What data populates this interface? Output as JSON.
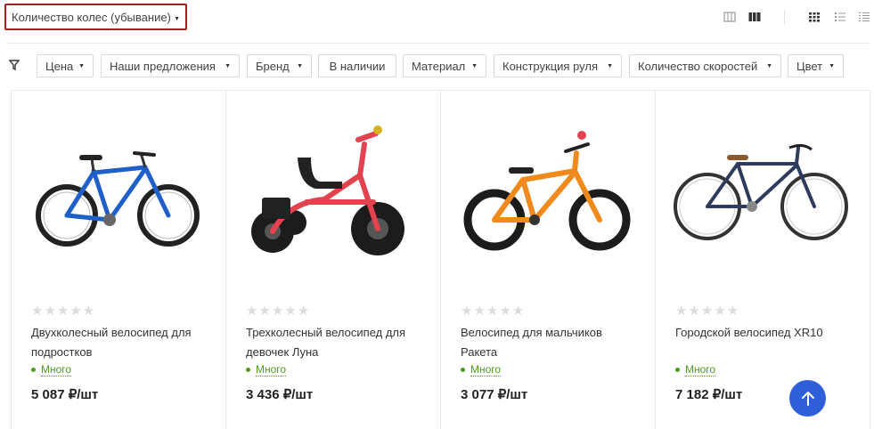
{
  "sort": {
    "label": "Количество колес (убывание)"
  },
  "view": {
    "icons": [
      "grid-small-icon",
      "grid-large-icon",
      "tile-view-icon",
      "list-view-icon",
      "compact-list-icon"
    ]
  },
  "filters": [
    {
      "label": "Цена"
    },
    {
      "label": "Наши предложения"
    },
    {
      "label": "Бренд"
    },
    {
      "label": "В наличии"
    },
    {
      "label": "Материал"
    },
    {
      "label": "Конструкция руля"
    },
    {
      "label": "Количество скоростей"
    },
    {
      "label": "Цвет"
    }
  ],
  "products": [
    {
      "name": "Двухколесный велосипед для подростков",
      "stock": "Много",
      "price": "5 087 ₽/шт",
      "rating": 0,
      "color": "#1f5fc9"
    },
    {
      "name": "Трехколесный велосипед для девочек Луна",
      "stock": "Много",
      "price": "3 436 ₽/шт",
      "rating": 0,
      "color": "#e2434f"
    },
    {
      "name": "Велосипед для мальчиков Ракета",
      "stock": "Много",
      "price": "3 077 ₽/шт",
      "rating": 0,
      "color": "#f08a1c"
    },
    {
      "name": "Городской велосипед XR10",
      "stock": "Много",
      "price": "7 182 ₽/шт",
      "rating": 0,
      "color": "#2f3b5c"
    }
  ],
  "colors": {
    "accent": "#2f5fd8",
    "sort_border": "#a3201e",
    "stock_green": "#4f9a1f"
  }
}
